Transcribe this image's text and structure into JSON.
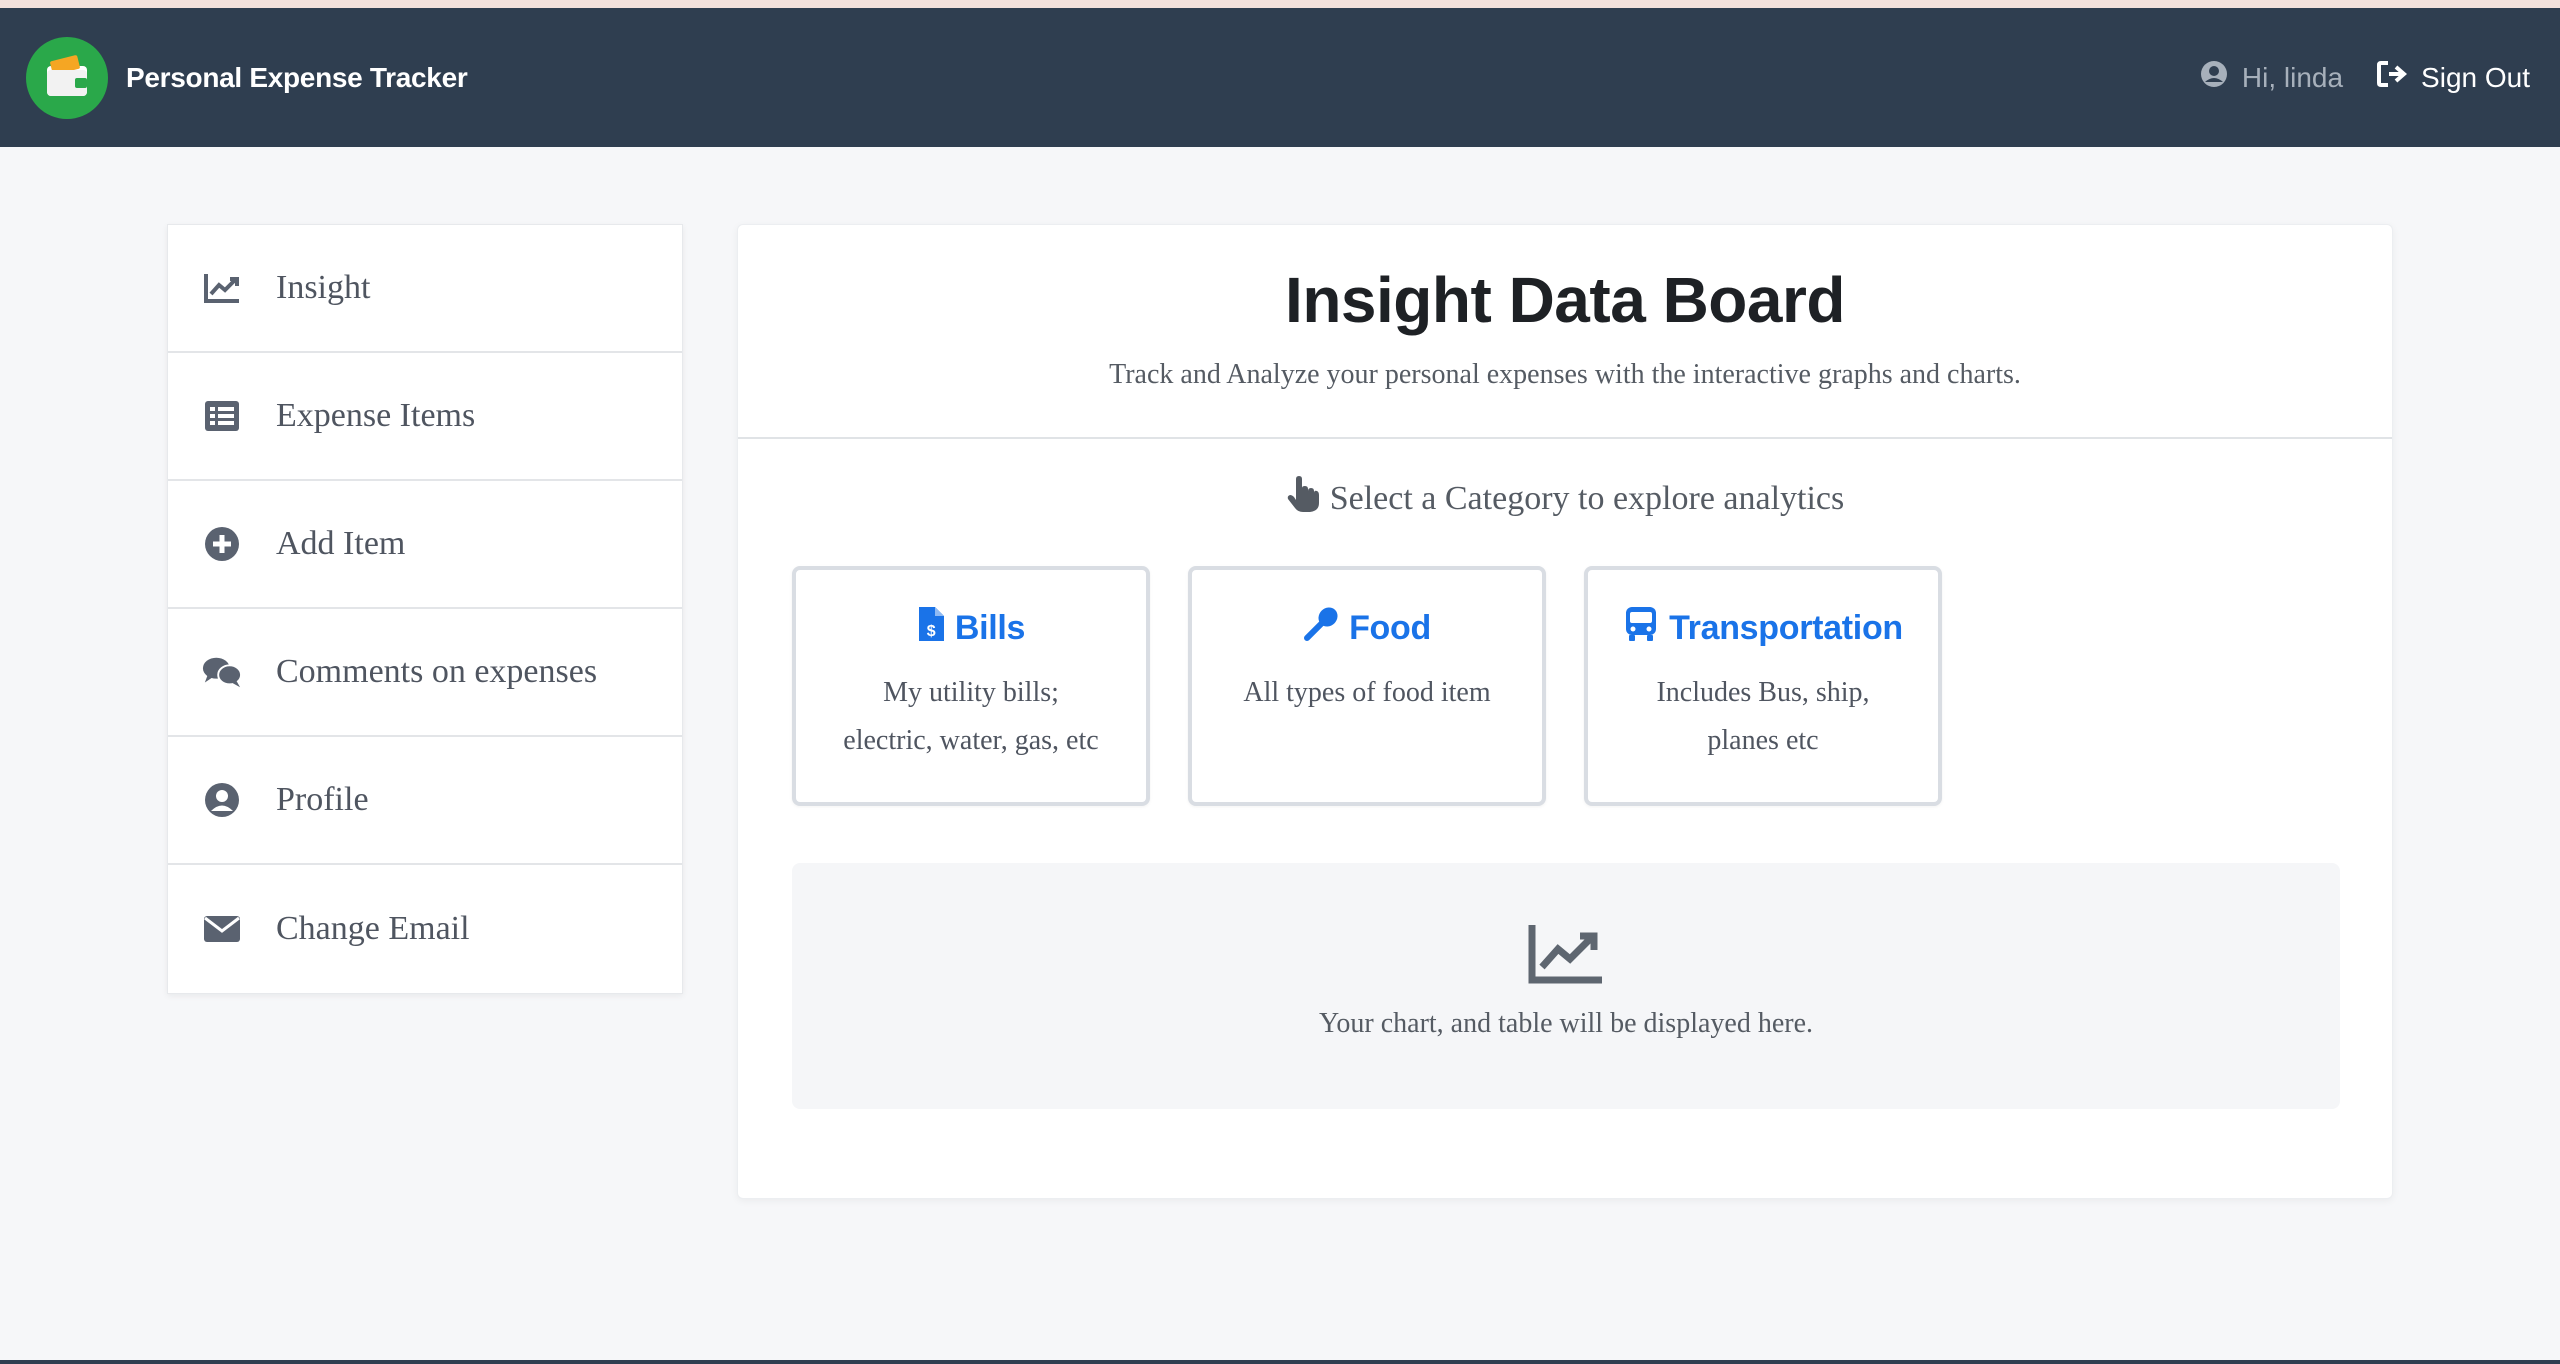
{
  "app": {
    "title": "Personal Expense Tracker"
  },
  "nav": {
    "greeting": "Hi, linda",
    "signout_label": "Sign Out"
  },
  "sidebar": {
    "items": [
      {
        "label": "Insight",
        "icon": "chart-line-icon"
      },
      {
        "label": "Expense Items",
        "icon": "list-icon"
      },
      {
        "label": "Add Item",
        "icon": "plus-circle-icon"
      },
      {
        "label": "Comments on expenses",
        "icon": "comments-icon"
      },
      {
        "label": "Profile",
        "icon": "user-circle-icon"
      },
      {
        "label": "Change Email",
        "icon": "envelope-icon"
      }
    ]
  },
  "main": {
    "title": "Insight Data Board",
    "subtitle": "Track and Analyze your personal expenses with the interactive graphs and charts.",
    "prompt": "Select a Category to explore analytics",
    "categories": [
      {
        "title": "Bills",
        "icon": "file-invoice-dollar-icon",
        "desc_line1": "My utility bills;",
        "desc_line2": "electric, water, gas, etc"
      },
      {
        "title": "Food",
        "icon": "spoon-icon",
        "desc_line1": "All types of food item",
        "desc_line2": ""
      },
      {
        "title": "Transportation",
        "icon": "bus-icon",
        "desc_line1": "Includes Bus, ship,",
        "desc_line2": "planes etc"
      }
    ],
    "placeholder": "Your chart, and table will be displayed here."
  },
  "colors": {
    "navbar": "#2f3e50",
    "accent": "#1a73e8",
    "logo": "#2aa84a"
  }
}
